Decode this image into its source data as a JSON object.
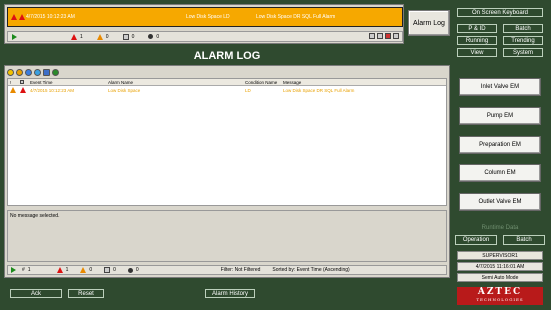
{
  "banner": {
    "alarm": {
      "time": "4/7/2015 10:12:23 AM",
      "name": "Low Disk Space LD",
      "message": "Low Disk Space DR SQL Full Alarm"
    },
    "status": {
      "count": "1",
      "unacked": "1",
      "ack": "0",
      "shelved": "0",
      "suppressed": "0"
    }
  },
  "alarm_log_button": "Alarm Log",
  "right_panel": {
    "onscreen_keyboard": "On Screen Keyboard",
    "nav": {
      "pid": "P & ID",
      "batch": "Batch",
      "running": "Running",
      "trending": "Trending",
      "view": "View",
      "system": "System"
    },
    "em_buttons": [
      "Inlet Valve EM",
      "Pump EM",
      "Preparation EM",
      "Column EM",
      "Outlet Valve EM"
    ],
    "runtime_label": "Runtime Data",
    "operation": "Operation",
    "batch_btn": "Batch",
    "user": "SUPERVISOR1",
    "datetime": "4/7/2015 11:16:01 AM",
    "mode": "Semi Auto Mode",
    "logo_big": "AZTEC",
    "logo_small": "TECHNOLOGIES"
  },
  "log": {
    "title": "ALARM LOG",
    "columns": {
      "ack": "!",
      "sev": " ",
      "time": "Event Time",
      "name": "Alarm Name",
      "cond": "Condition Name",
      "msg": "Message"
    },
    "rows": [
      {
        "time": "4/7/2015 10:12:23 AM",
        "name": "Low Disk Space",
        "cond": "LD",
        "msg": "Low Disk Space DR SQL Full Alarm"
      }
    ],
    "message_pane": "No message selected.",
    "status": {
      "total": "1",
      "unacked": "1",
      "ack": "0",
      "shelved": "0",
      "suppressed": "0",
      "filter": "Filter: Not Filtered",
      "sort": "Sorted by: Event Time (Ascending)"
    }
  },
  "bottom": {
    "ack": "Ack",
    "reset": "Reset",
    "alarm_history": "Alarm History"
  },
  "colors": {
    "background": "#2f4a2f",
    "alarm_banner": "#f6a800",
    "alarm_text": "#e8a000",
    "logo": "#b81a1a"
  }
}
